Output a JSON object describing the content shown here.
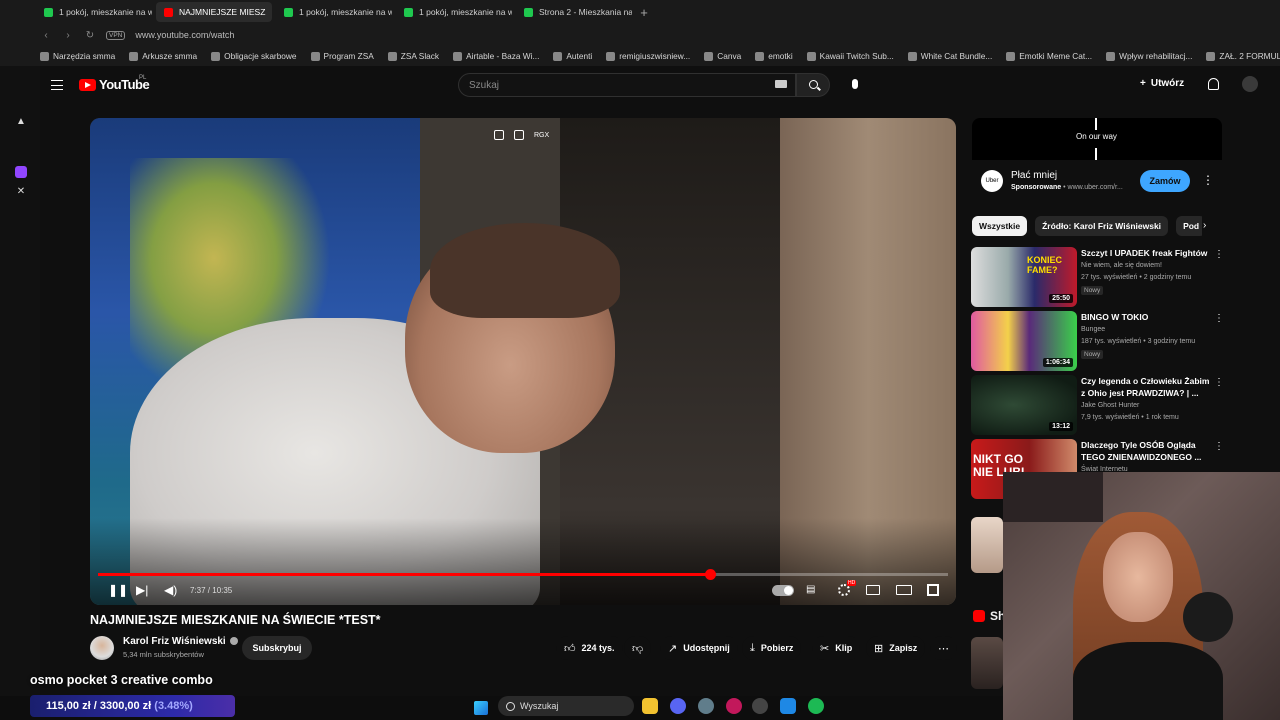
{
  "browser": {
    "tabs": [
      {
        "label": "1 pokój, mieszkanie na wy",
        "icon": "otodom-icon",
        "active": false
      },
      {
        "label": "NAJMNIEJSZE MIESZ",
        "icon": "youtube-icon",
        "active": true
      },
      {
        "label": "1 pokój, mieszkanie na wy",
        "icon": "otodom-icon",
        "active": false
      },
      {
        "label": "1 pokój, mieszkanie na wy",
        "icon": "otodom-icon",
        "active": false
      },
      {
        "label": "Strona 2 - Mieszkania na",
        "icon": "otodom-icon",
        "active": false
      }
    ],
    "new_tab": "+",
    "vpn": "VPN",
    "url": "www.youtube.com/watch",
    "bookmarks": [
      "Narzędzia smma",
      "Arkusze smma",
      "Obligacje skarbowe",
      "Program ZSA",
      "ZSA Slack",
      "Airtable - Baza Wi...",
      "Autenti",
      "remigiuszwisniew...",
      "Canva",
      "emotki",
      "Kawaii Twitch Sub...",
      "White Cat Bundle...",
      "Emotki Meme Cat...",
      "Wpływ rehabilitacj...",
      "ZAŁ. 2 FORMULAR..."
    ]
  },
  "youtube": {
    "logo_text": "YouTube",
    "country": "PL",
    "search_placeholder": "Szukaj",
    "create_label": "Utwórz",
    "video": {
      "overlay_label": "RGX",
      "time": "7:37 / 10:35",
      "progress": 0.72,
      "title": "NAJMNIEJSZE MIESZKANIE NA ŚWIECIE *TEST*"
    },
    "channel": {
      "name": "Karol Friz Wiśniewski",
      "subscribers": "5,34 mln subskrybentów",
      "subscribe_label": "Subskrybuj"
    },
    "actions": {
      "likes": "224 tys.",
      "share": "Udostępnij",
      "download": "Pobierz",
      "clip": "Klip",
      "save": "Zapisz"
    },
    "ad": {
      "banner_text": "On our way",
      "title": "Płać mniej",
      "sponsored": "Sponsorowane",
      "domain": "www.uber.com/r...",
      "button": "Zamów",
      "brand": "Uber"
    },
    "chips": [
      "Wszystkie",
      "Źródło: Karol Friz Wiśniewski",
      "Pod"
    ],
    "recommendations": [
      {
        "title": "Szczyt I UPADEK freak Fightów",
        "channel": "Nie wiem, ale się dowiem!",
        "meta": "27 tys. wyświetleń • 2 godziny temu",
        "badge": "Nowy",
        "duration": "25:50",
        "thumb_text": "KONIEC FAME?"
      },
      {
        "title": "BINGO W TOKIO",
        "channel": "Bungee",
        "meta": "187 tys. wyświetleń • 3 godziny temu",
        "badge": "Nowy",
        "duration": "1:06:34"
      },
      {
        "title": "Czy legenda o Człowieku Żabim z Ohio jest PRAWDZIWA? | ...",
        "channel": "Jake Ghost Hunter",
        "meta": "7,9 tys. wyświetleń • 1 rok temu",
        "duration": "13:12"
      },
      {
        "title": "Dlaczego Tyle OSÓB Ogląda TEGO ZNIENAWIDZONEGO ...",
        "channel": "Świat Internetu",
        "thumb_text": "NIKT GO NIE LUBI"
      }
    ],
    "shorts_label": "Sh"
  },
  "stream_overlay": {
    "text": "osmo pocket 3 creative combo",
    "goal_current": "115,00 zł",
    "goal_sep": "/",
    "goal_target": "3300,00 zł",
    "goal_percent": "(3.48%)",
    "goal_fraction": 0.0348
  },
  "taskbar": {
    "search_label": "Wyszukaj"
  },
  "colors": {
    "youtube_red": "#ff0000",
    "accent_blue": "#3ea6ff",
    "background": "#0f0f0f"
  }
}
